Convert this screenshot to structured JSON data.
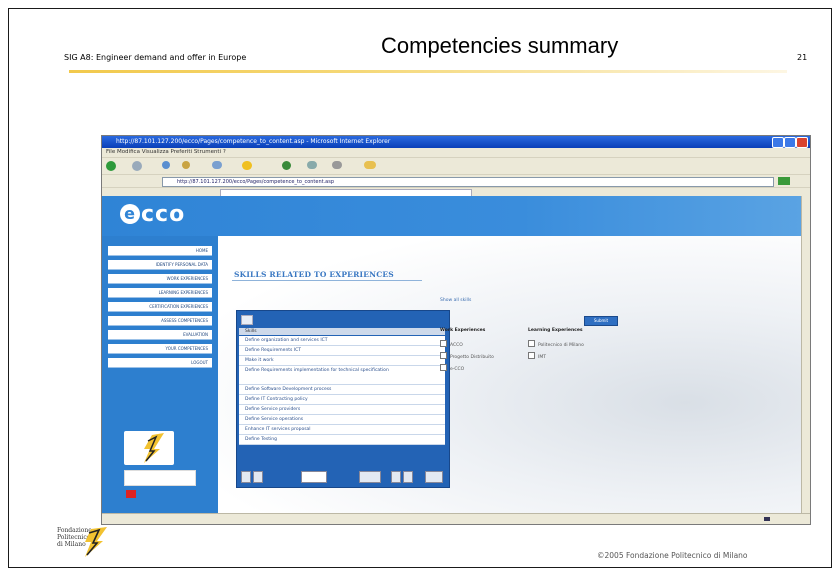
{
  "slide": {
    "subtitle": "SIG A8: Engineer demand and offer in Europe",
    "title": "Competencies summary",
    "page_number": "21",
    "copyright": "©2005 Fondazione Politecnico di Milano",
    "footer_logo_text": "Fondazione\nPolitecnico\ndi Milano"
  },
  "browser": {
    "window_title": "http://87.101.127.200/ecco/Pages/competence_to_content.asp - Microsoft Internet Explorer",
    "menu": "File  Modifica  Visualizza  Preferiti  Strumenti  ?",
    "address": "http://87.101.127.200/ecco/Pages/competence_to_content.asp"
  },
  "site": {
    "logo": "ecco",
    "section_title": "SKILLS RELATED TO EXPERIENCES",
    "nav_items": [
      "HOME",
      "IDENTIFY PERSONAL DATA",
      "WORK EXPERIENCES",
      "LEARNING EXPERIENCES",
      "CERTIFICATION EXPERIENCES",
      "ASSESS COMPETENCES",
      "EVALUATION",
      "YOUR COMPETENCES",
      "LOGOUT"
    ],
    "list_header": "Skills",
    "list_rows": [
      "Define organization and services ICT",
      "Define Requirements ICT",
      "Make it work",
      "Define Requirements implementation for technical specification",
      "Define Software Development process",
      "Define IT Contracting policy",
      "Define Service providers",
      "Define Service operations",
      "Enhance IT services proposal",
      "Define Testing"
    ],
    "show_all_link": "Show all skills",
    "go_button": "Submit",
    "work_head": "Work Experiences",
    "learning_head": "Learning Experiences",
    "work_options": [
      "ACCO",
      "Progetto Distribuito",
      "e-CCO"
    ],
    "learning_options": [
      "Politecnico di Milano",
      "IMT"
    ]
  }
}
